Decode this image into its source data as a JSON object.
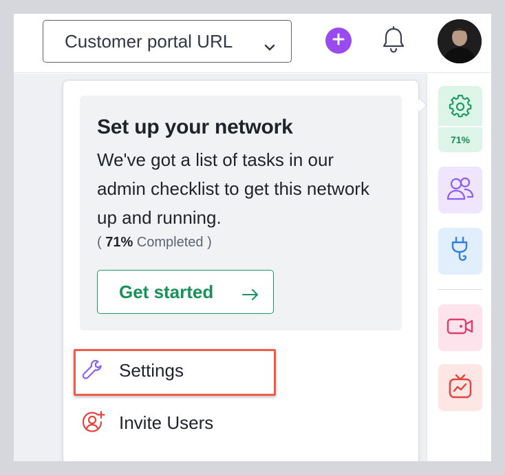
{
  "header": {
    "portal_button_label": "Customer portal URL",
    "icons": [
      "chevron-down-icon",
      "plus-icon",
      "bell-icon",
      "avatar"
    ],
    "colors": {
      "plus": "#9a4bf0"
    }
  },
  "setup_card": {
    "title": "Set up your network",
    "description": "We've got a list of tasks in our admin checklist to get this network up and running.",
    "progress_open": "( ",
    "progress_value": "71%",
    "progress_label": " Completed )",
    "cta_label": "Get started",
    "cta_color": "#17915a"
  },
  "menu": {
    "items": [
      {
        "label": "Settings",
        "icon": "wrench-icon",
        "highlighted": true
      },
      {
        "label": "Invite Users",
        "icon": "user-plus-icon"
      }
    ]
  },
  "right_sidebar": {
    "settings_progress": "71%",
    "items": [
      "gear-icon",
      "users-icon",
      "plug-icon",
      "video-icon",
      "live-tv-icon"
    ]
  }
}
